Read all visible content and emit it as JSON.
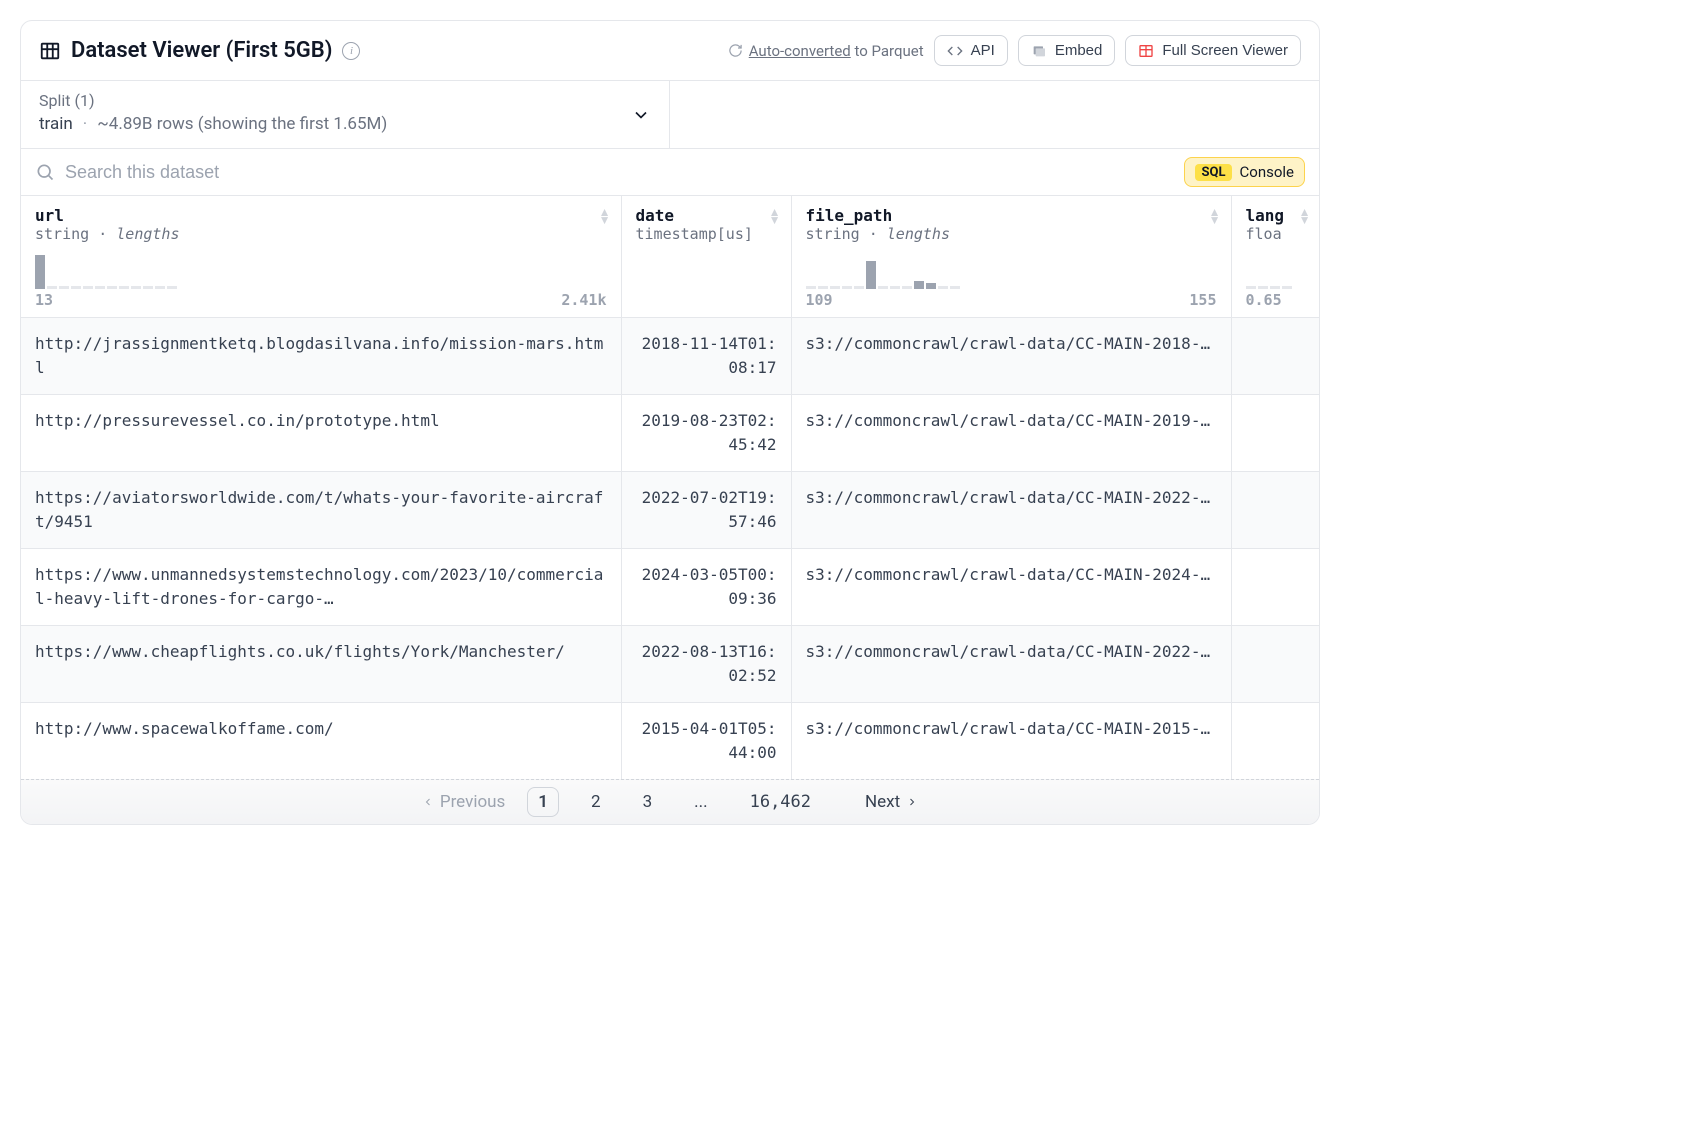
{
  "header": {
    "title": "Dataset Viewer (First 5GB)",
    "autoconvert_prefix": "Auto-converted",
    "autoconvert_suffix": " to Parquet",
    "api": "API",
    "embed": "Embed",
    "fullscreen": "Full Screen Viewer"
  },
  "split": {
    "label": "Split (1)",
    "name": "train",
    "rows": "~4.89B rows (showing the first 1.65M)"
  },
  "search": {
    "placeholder": "Search this dataset"
  },
  "sql": {
    "badge": "SQL",
    "console": "Console"
  },
  "columns": [
    {
      "name": "url",
      "type_prefix": "string",
      "type_suffix": "lengths",
      "hist_min": "13",
      "hist_max": "2.41k",
      "has_hist": true,
      "bars": [
        34,
        3,
        3,
        3,
        3,
        3,
        3,
        3,
        3,
        3,
        3,
        3
      ]
    },
    {
      "name": "date",
      "type_prefix": "timestamp[us]",
      "type_suffix": "",
      "has_hist": false
    },
    {
      "name": "file_path",
      "type_prefix": "string",
      "type_suffix": "lengths",
      "hist_min": "109",
      "hist_max": "155",
      "has_hist": true,
      "bars": [
        3,
        3,
        3,
        3,
        3,
        28,
        3,
        3,
        3,
        8,
        6,
        3,
        3
      ]
    },
    {
      "name": "lang",
      "type_prefix": "floa",
      "type_suffix": "",
      "hist_min": "0.65",
      "hist_max": "",
      "has_hist": true,
      "bars": [
        3,
        3,
        3,
        3
      ]
    }
  ],
  "rows": [
    {
      "url": "http://jrassignmentketq.blogdasilvana.info/mission-mars.html",
      "date": "2018-11-14T01:08:17",
      "file_path": "s3://commoncrawl/crawl-data/CC-MAIN-2018-…"
    },
    {
      "url": "http://pressurevessel.co.in/prototype.html",
      "date": "2019-08-23T02:45:42",
      "file_path": "s3://commoncrawl/crawl-data/CC-MAIN-2019-…"
    },
    {
      "url": "https://aviatorsworldwide.com/t/whats-your-favorite-aircraft/9451",
      "date": "2022-07-02T19:57:46",
      "file_path": "s3://commoncrawl/crawl-data/CC-MAIN-2022-…"
    },
    {
      "url": "https://www.unmannedsystemstechnology.com/2023/10/commercial-heavy-lift-drones-for-cargo-…",
      "date": "2024-03-05T00:09:36",
      "file_path": "s3://commoncrawl/crawl-data/CC-MAIN-2024-…"
    },
    {
      "url": "https://www.cheapflights.co.uk/flights/York/Manchester/",
      "date": "2022-08-13T16:02:52",
      "file_path": "s3://commoncrawl/crawl-data/CC-MAIN-2022-…"
    },
    {
      "url": "http://www.spacewalkoffame.com/",
      "date": "2015-04-01T05:44:00",
      "file_path": "s3://commoncrawl/crawl-data/CC-MAIN-2015-…"
    }
  ],
  "pagination": {
    "previous": "Previous",
    "pages": [
      "1",
      "2",
      "3",
      "...",
      "16,462"
    ],
    "next": "Next",
    "current": "1"
  }
}
